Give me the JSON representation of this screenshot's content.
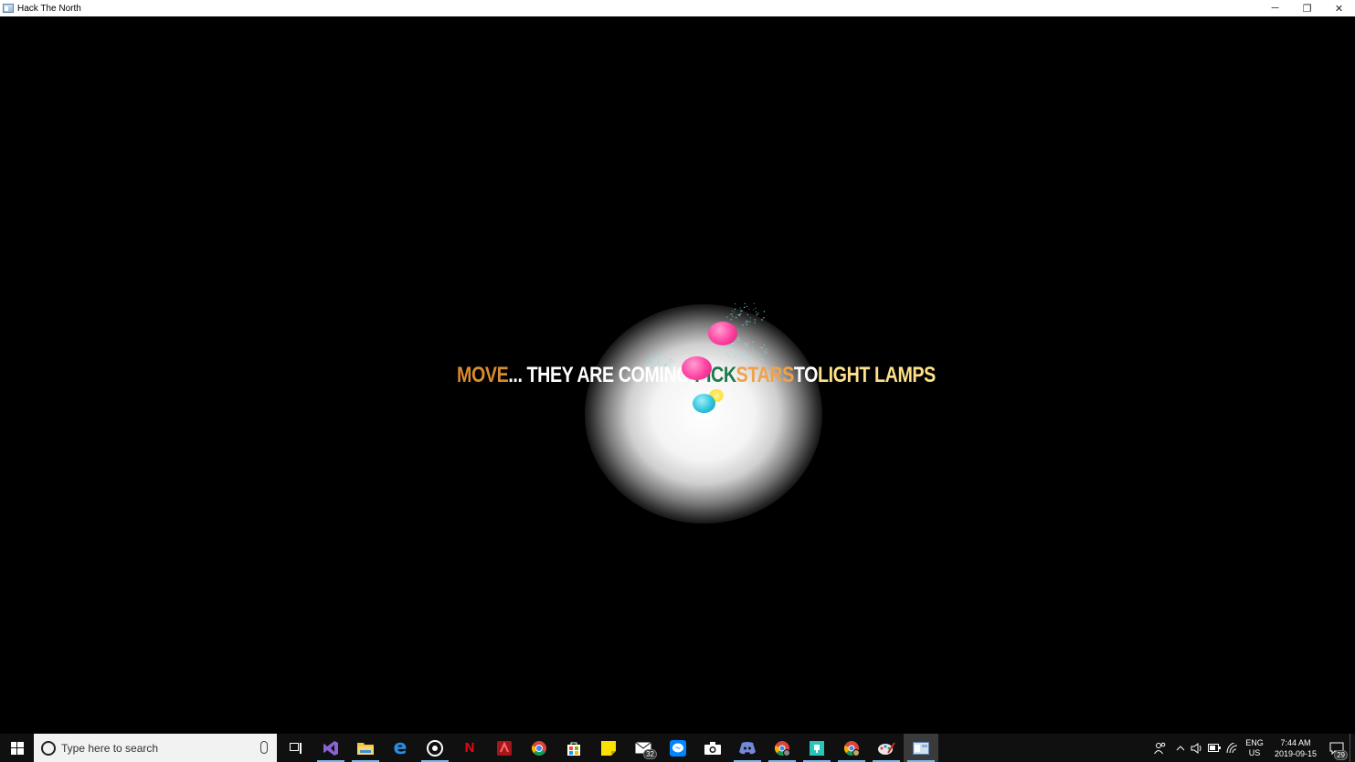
{
  "window": {
    "title": "Hack The North",
    "minimize_glyph": "─",
    "restore_glyph": "❐",
    "close_glyph": "✕"
  },
  "game": {
    "message": {
      "w1": "MOVE",
      "w2": "... THEY ARE COMING, ",
      "w3": "PICK",
      "w4": " STARS",
      "w5": " TO ",
      "w6": "LIGHT LAMPS"
    },
    "colors": {
      "move": "#d98b2e",
      "white": "#ffffff",
      "pick": "#1f7a4d",
      "stars": "#f0a24a",
      "lamps": "#ffe08a",
      "pink_blob": "#ff3fa0",
      "cyan_blob": "#2ec4dc",
      "yellow_blob": "#ffe23a",
      "particles": "#7fe3e8"
    }
  },
  "taskbar": {
    "search_placeholder": "Type here to search",
    "icons": [
      {
        "name": "task-view-icon"
      },
      {
        "name": "visual-studio-icon"
      },
      {
        "name": "file-explorer-icon"
      },
      {
        "name": "edge-icon"
      },
      {
        "name": "groove-icon"
      },
      {
        "name": "netflix-icon"
      },
      {
        "name": "red-app-icon"
      },
      {
        "name": "chrome-icon"
      },
      {
        "name": "store-icon"
      },
      {
        "name": "sticky-notes-icon"
      },
      {
        "name": "mail-icon",
        "badge": "32"
      },
      {
        "name": "messenger-icon"
      },
      {
        "name": "camera-icon"
      },
      {
        "name": "discord-icon"
      },
      {
        "name": "chrome-profile-icon"
      },
      {
        "name": "teal-app-icon"
      },
      {
        "name": "chrome-profile-2-icon"
      },
      {
        "name": "paint-icon"
      },
      {
        "name": "game-window-icon"
      }
    ],
    "tray": {
      "lang_top": "ENG",
      "lang_bottom": "US",
      "time": "7:44 AM",
      "date": "2019-09-15",
      "notifications": "29"
    }
  }
}
